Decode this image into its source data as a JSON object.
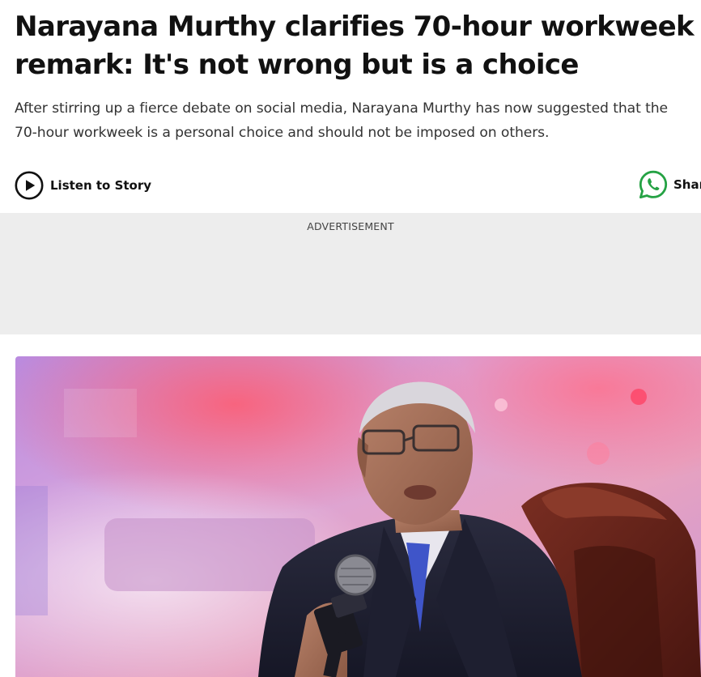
{
  "article": {
    "headline": "Narayana Murthy clarifies 70-hour workweek remark: It's not wrong but is a choice",
    "summary": "After stirring up a fierce debate on social media, Narayana Murthy has now suggested that the 70-hour workweek is a personal choice and should not be imposed on others."
  },
  "actions": {
    "listen_label": "Listen to Story",
    "share_label": "Share",
    "play_icon": "play-icon",
    "whatsapp_icon": "whatsapp-icon"
  },
  "advertisement": {
    "label": "ADVERTISEMENT"
  },
  "colors": {
    "headline": "#111111",
    "summary": "#333333",
    "ad_background": "#ededed",
    "whatsapp_green": "#25a244"
  }
}
